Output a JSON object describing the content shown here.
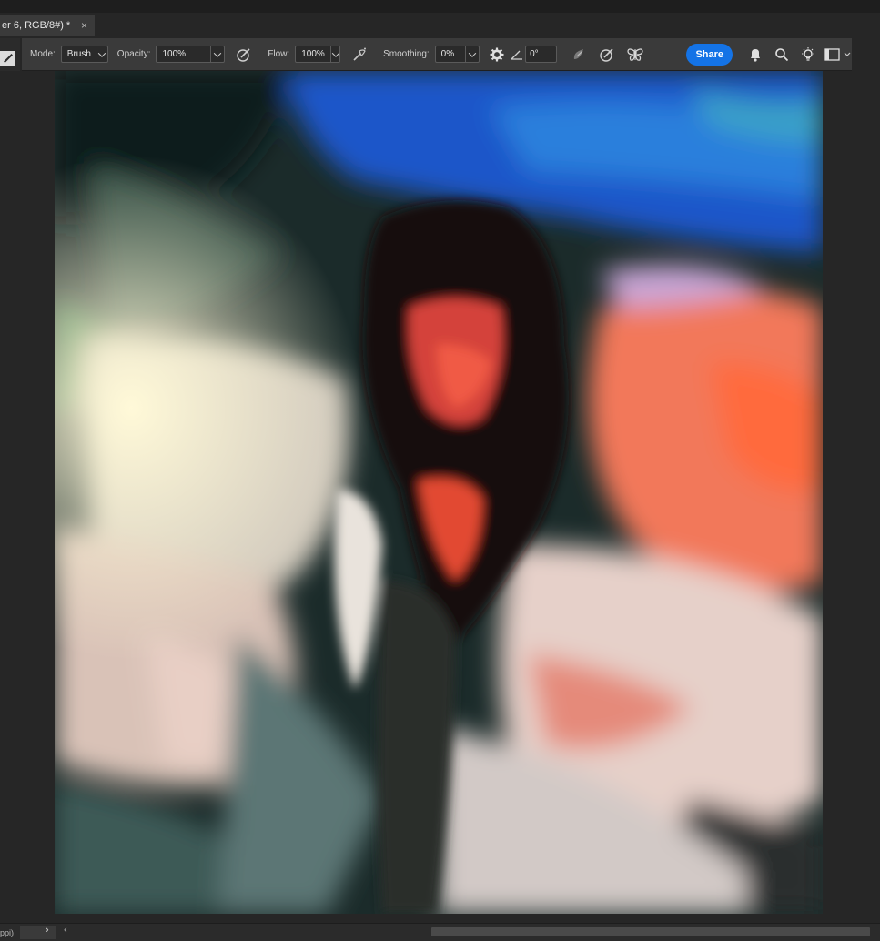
{
  "document_tab": {
    "title": "er 6, RGB/8#) *",
    "close_glyph": "×"
  },
  "toolbar": {
    "mode_label": "Mode:",
    "mode_value": "Brush",
    "opacity_label": "Opacity:",
    "opacity_value": "100%",
    "flow_label": "Flow:",
    "flow_value": "100%",
    "smoothing_label": "Smoothing:",
    "smoothing_value": "0%",
    "angle_value": "0°",
    "share_label": "Share",
    "icons": [
      "pressure-opacity-icon",
      "airbrush-icon",
      "settings-gear-icon",
      "angle-icon",
      "pressure-size-icon",
      "symmetry-icon",
      "notification-bell-icon",
      "search-icon",
      "discover-lightbulb-icon",
      "workspace-panel-icon"
    ]
  },
  "status_bar": {
    "zoom_text": "ppi)"
  },
  "colors": {
    "accent": "#1473e6",
    "toolbar_bg": "#3a3a3a",
    "app_bg": "#262626"
  }
}
